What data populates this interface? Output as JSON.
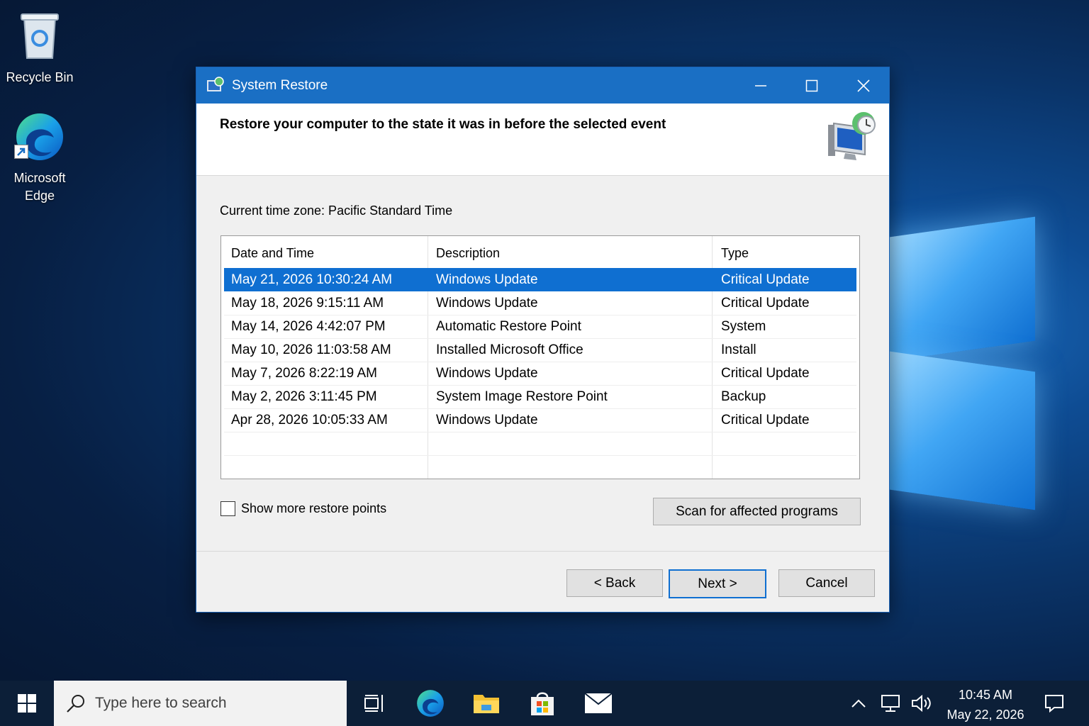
{
  "desktop": {
    "icons": [
      {
        "label": "Recycle Bin",
        "icon": "recycle-bin-icon"
      },
      {
        "label": "Microsoft\nEdge",
        "line1": "Microsoft",
        "line2": "Edge",
        "icon": "edge-icon"
      }
    ]
  },
  "window": {
    "title": "System Restore",
    "icon": "system-restore-icon",
    "controls": {
      "minimize": "minimize-icon",
      "maximize": "maximize-icon",
      "close": "close-icon"
    },
    "header": "Restore your computer to the state it was in before the selected event",
    "timezone": "Current time zone: Pacific Standard Time",
    "table": {
      "columns": [
        "Date and Time",
        "Description",
        "Type"
      ],
      "rows": [
        {
          "date": "May 21, 2026 10:30:24 AM",
          "desc": "Windows Update",
          "type": "Critical Update",
          "selected": true
        },
        {
          "date": "May 18, 2026 9:15:11 AM",
          "desc": "Windows Update",
          "type": "Critical Update"
        },
        {
          "date": "May 14, 2026 4:42:07 PM",
          "desc": "Automatic Restore Point",
          "type": "System"
        },
        {
          "date": "May 10, 2026 11:03:58 AM",
          "desc": "Installed Microsoft Office",
          "type": "Install"
        },
        {
          "date": "May 7, 2026 8:22:19 AM",
          "desc": "Windows Update",
          "type": "Critical Update"
        },
        {
          "date": "May 2, 2026 3:11:45 PM",
          "desc": "System Image Restore Point",
          "type": "Backup"
        },
        {
          "date": "Apr 28, 2026 10:05:33 AM",
          "desc": "Windows Update",
          "type": "Critical Update"
        }
      ]
    },
    "show_more_label": "Show more restore points",
    "show_more_checked": false,
    "scan_button": "Scan for affected programs",
    "back_button": "< Back",
    "next_button": "Next >",
    "cancel_button": "Cancel"
  },
  "taskbar": {
    "search_placeholder": "Type here to search",
    "apps": [
      "task-view-icon",
      "edge-icon",
      "file-explorer-icon",
      "store-icon",
      "mail-icon"
    ],
    "tray": [
      "chevron-up-icon",
      "network-icon",
      "volume-icon"
    ],
    "time": "10:45 AM",
    "date": "May 22, 2026",
    "notification_icon": "action-center-icon"
  },
  "colors": {
    "accent": "#0f6fd1",
    "titlebar": "#1a6fc4",
    "taskbar": "#0c1f38"
  }
}
